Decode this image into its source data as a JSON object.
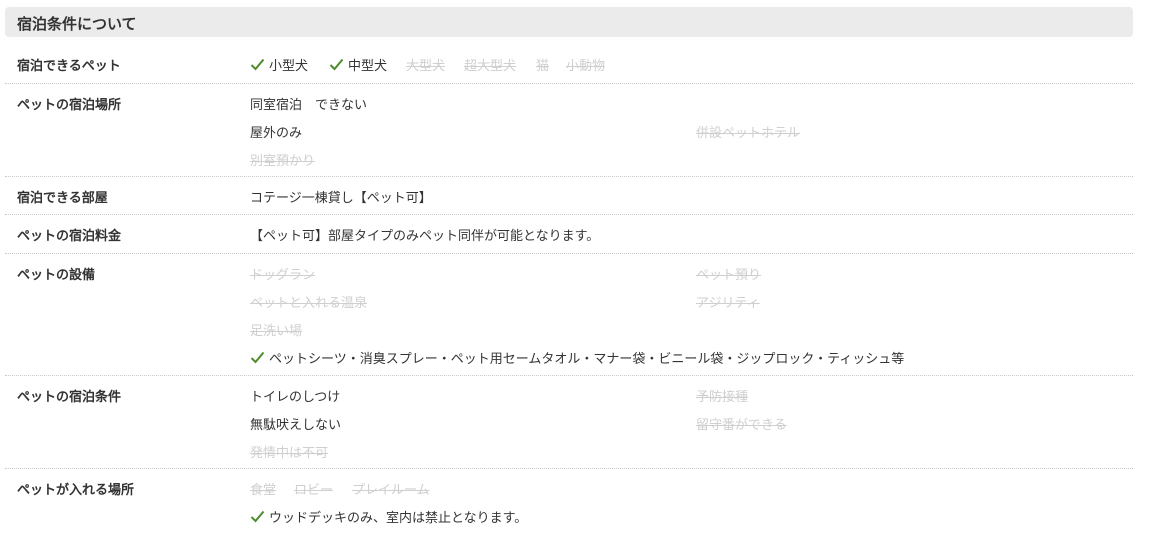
{
  "section_title": "宿泊条件について",
  "colors": {
    "check": "#4c8c2b",
    "text": "#333333",
    "disabled": "#cfcfcf",
    "header_bg": "#ebebeb"
  },
  "rows": [
    {
      "label": "宿泊できるペット",
      "items": [
        {
          "text": "小型犬",
          "on": true
        },
        {
          "text": "中型犬",
          "on": true
        },
        {
          "text": "大型犬",
          "on": false
        },
        {
          "text": "超大型犬",
          "on": false
        },
        {
          "text": "猫",
          "on": false
        },
        {
          "text": "小動物",
          "on": false
        }
      ]
    },
    {
      "label": "ペットの宿泊場所",
      "items": [
        {
          "text": "同室宿泊　できない",
          "on": true
        },
        {
          "text": "屋外のみ",
          "on": true
        },
        {
          "text": "併設ペットホテル",
          "on": false
        },
        {
          "text": "別室預かり",
          "on": false
        }
      ]
    },
    {
      "label": "宿泊できる部屋",
      "items": [
        {
          "text": "コテージ一棟貸し【ペット可】",
          "on": true
        }
      ]
    },
    {
      "label": "ペットの宿泊料金",
      "items": [
        {
          "text": "【ペット可】部屋タイプのみペット同伴が可能となります。",
          "on": true
        }
      ]
    },
    {
      "label": "ペットの設備",
      "items": [
        {
          "text": "ドッグラン",
          "on": false
        },
        {
          "text": "ペット預り",
          "on": false
        },
        {
          "text": "ペットと入れる温泉",
          "on": false
        },
        {
          "text": "アジリティ",
          "on": false
        },
        {
          "text": "足洗い場",
          "on": false
        },
        {
          "text": "ペットシーツ・消臭スプレー・ペット用セームタオル・マナー袋・ビニール袋・ジップロック・ティッシュ等",
          "on": true
        }
      ]
    },
    {
      "label": "ペットの宿泊条件",
      "items": [
        {
          "text": "トイレのしつけ",
          "on": true
        },
        {
          "text": "予防接種",
          "on": false
        },
        {
          "text": "無駄吠えしない",
          "on": true
        },
        {
          "text": "留守番ができる",
          "on": false
        },
        {
          "text": "発情中は不可",
          "on": false
        }
      ]
    },
    {
      "label": "ペットが入れる場所",
      "items": [
        {
          "text": "食堂",
          "on": false
        },
        {
          "text": "ロビー",
          "on": false
        },
        {
          "text": "プレイルーム",
          "on": false
        },
        {
          "text": "ウッドデッキのみ、室内は禁止となります。",
          "on": true
        }
      ]
    }
  ]
}
